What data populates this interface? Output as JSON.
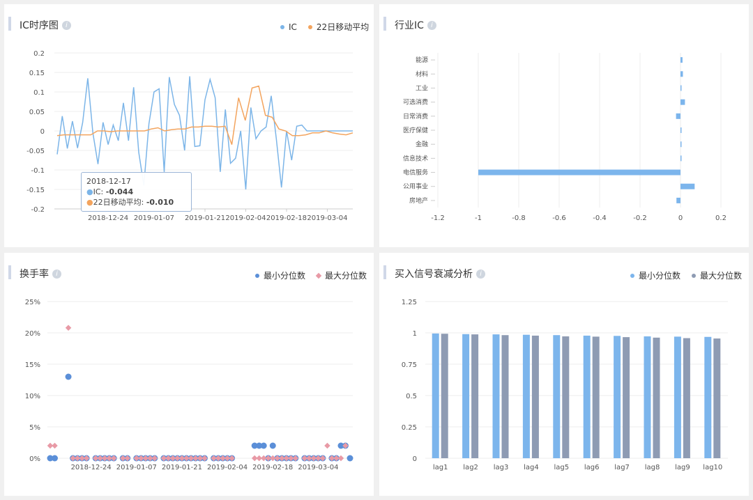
{
  "panels": {
    "p1": {
      "title": "IC时序图"
    },
    "p2": {
      "title": "行业IC"
    },
    "p3": {
      "title": "换手率"
    },
    "p4": {
      "title": "买入信号衰减分析"
    }
  },
  "colors": {
    "ic": "#7cb5e8",
    "ma": "#f3a45e",
    "min_q": "#5b8fd8",
    "max_q": "#e89aa6",
    "bar_blue": "#7cb5ec",
    "bar_gray": "#8e9bb3"
  },
  "tooltip": {
    "date": "2018-12-17",
    "ic_label": "IC: ",
    "ic_value": "-0.044",
    "ma_label": "22日移动平均: ",
    "ma_value": "-0.010"
  },
  "chart_data": [
    {
      "type": "line",
      "legend": [
        "IC",
        "22日移动平均"
      ],
      "ylim": [
        -0.2,
        0.2
      ],
      "yticks": [
        "0.2",
        "0.15",
        "0.1",
        "0.05",
        "0",
        "-0.05",
        "-0.1",
        "-0.15",
        "-0.2"
      ],
      "xticks": [
        "2018-12-24",
        "2019-01-07",
        "2019-01-21",
        "2019-02-04",
        "2019-02-18",
        "2019-03-04"
      ],
      "series": [
        {
          "name": "IC",
          "x": [
            "2018-12-10",
            "2018-12-11",
            "2018-12-12",
            "2018-12-13",
            "2018-12-14",
            "2018-12-17",
            "2018-12-18",
            "2018-12-19",
            "2018-12-20",
            "2018-12-21",
            "2018-12-24",
            "2018-12-25",
            "2018-12-26",
            "2018-12-27",
            "2018-12-28",
            "2019-01-02",
            "2019-01-03",
            "2019-01-04",
            "2019-01-07",
            "2019-01-08",
            "2019-01-09",
            "2019-01-10",
            "2019-01-11",
            "2019-01-14",
            "2019-01-15",
            "2019-01-16",
            "2019-01-17",
            "2019-01-18",
            "2019-01-21",
            "2019-01-22",
            "2019-01-23",
            "2019-01-24",
            "2019-01-25",
            "2019-01-28",
            "2019-01-29",
            "2019-01-30",
            "2019-01-31",
            "2019-02-01",
            "2019-02-11",
            "2019-02-12",
            "2019-02-13",
            "2019-02-14",
            "2019-02-15",
            "2019-02-18",
            "2019-02-19",
            "2019-02-20",
            "2019-02-21",
            "2019-02-22",
            "2019-02-25",
            "2019-02-26",
            "2019-02-27",
            "2019-02-28",
            "2019-03-01",
            "2019-03-04",
            "2019-03-05",
            "2019-03-06",
            "2019-03-07",
            "2019-03-08",
            "2019-03-11"
          ],
          "values": [
            -0.06,
            0.038,
            -0.045,
            0.025,
            -0.044,
            0.022,
            0.135,
            -0.005,
            -0.085,
            0.022,
            -0.035,
            0.015,
            -0.025,
            0.072,
            -0.025,
            0.112,
            -0.055,
            -0.14,
            0.018,
            0.1,
            0.108,
            -0.105,
            0.138,
            0.068,
            0.04,
            -0.05,
            0.14,
            -0.04,
            -0.038,
            0.08,
            0.132,
            0.085,
            -0.105,
            0.055,
            -0.083,
            -0.07,
            0.0,
            -0.15,
            0.06,
            -0.02,
            0.0,
            0.01,
            0.09,
            -0.02,
            -0.145,
            0.0,
            -0.075,
            0.012,
            0.015,
            0.0,
            0.0,
            0.0,
            0.0,
            0.0,
            0.0,
            0.0,
            0.0,
            0.0,
            0.0
          ]
        },
        {
          "name": "22日移动平均",
          "values": [
            -0.012,
            -0.01,
            -0.01,
            -0.01,
            -0.01,
            -0.01,
            0.0,
            0.0,
            -0.002,
            0.0,
            0.0,
            0.0,
            0.0,
            0.0,
            0.005,
            0.008,
            0.0,
            0.003,
            0.005,
            0.005,
            0.01,
            0.01,
            0.012,
            0.012,
            0.01,
            0.012,
            -0.035,
            0.085,
            0.027,
            0.11,
            0.115,
            0.04,
            0.035,
            0.005,
            0.0,
            -0.012,
            -0.012,
            -0.01,
            -0.005,
            -0.005,
            0.0,
            -0.005,
            -0.008,
            -0.01,
            -0.005
          ]
        }
      ]
    },
    {
      "type": "bar",
      "orientation": "horizontal",
      "categories": [
        "能源",
        "材料",
        "工业",
        "可选消费",
        "日常消费",
        "医疗保健",
        "金融",
        "信息技术",
        "电信服务",
        "公用事业",
        "房地产"
      ],
      "values": [
        0.01,
        0.012,
        0.0,
        0.022,
        -0.022,
        0.0,
        0.005,
        0.0,
        -1.0,
        0.07,
        -0.02
      ],
      "xticks": [
        "-1.2",
        "-1",
        "-0.8",
        "-0.6",
        "-0.4",
        "-0.2",
        "0",
        "0.2"
      ],
      "xlim": [
        -1.2,
        0.2
      ]
    },
    {
      "type": "scatter",
      "legend": [
        "最小分位数",
        "最大分位数"
      ],
      "yticks": [
        "25%",
        "20%",
        "15%",
        "10%",
        "5%",
        "0%"
      ],
      "ylim": [
        0,
        25
      ],
      "xticks": [
        "2018-12-24",
        "2019-01-07",
        "2019-01-21",
        "2019-02-04",
        "2019-02-18",
        "2019-03-04"
      ],
      "series": [
        {
          "name": "最小分位数",
          "points": [
            [
              0,
              0
            ],
            [
              1,
              0
            ],
            [
              4,
              13
            ],
            [
              5,
              0
            ],
            [
              6,
              0
            ],
            [
              7,
              0
            ],
            [
              8,
              0
            ],
            [
              10,
              0
            ],
            [
              11,
              0
            ],
            [
              12,
              0
            ],
            [
              13,
              0
            ],
            [
              14,
              0
            ],
            [
              16,
              0
            ],
            [
              17,
              0
            ],
            [
              19,
              0
            ],
            [
              20,
              0
            ],
            [
              21,
              0
            ],
            [
              22,
              0
            ],
            [
              23,
              0
            ],
            [
              25,
              0
            ],
            [
              26,
              0
            ],
            [
              27,
              0
            ],
            [
              28,
              0
            ],
            [
              29,
              0
            ],
            [
              30,
              0
            ],
            [
              31,
              0
            ],
            [
              32,
              0
            ],
            [
              33,
              0
            ],
            [
              34,
              0
            ],
            [
              36,
              0
            ],
            [
              37,
              0
            ],
            [
              38,
              0
            ],
            [
              39,
              0
            ],
            [
              40,
              0
            ],
            [
              45,
              2
            ],
            [
              46,
              2
            ],
            [
              47,
              2
            ],
            [
              48,
              0
            ],
            [
              49,
              2
            ],
            [
              50,
              0
            ],
            [
              51,
              0
            ],
            [
              52,
              0
            ],
            [
              53,
              0
            ],
            [
              54,
              0
            ],
            [
              56,
              0
            ],
            [
              57,
              0
            ],
            [
              58,
              0
            ],
            [
              59,
              0
            ],
            [
              60,
              0
            ],
            [
              62,
              0
            ],
            [
              63,
              0
            ],
            [
              64,
              2
            ],
            [
              65,
              2
            ],
            [
              66,
              0
            ]
          ]
        },
        {
          "name": "最大分位数",
          "points": [
            [
              0,
              2
            ],
            [
              1,
              2
            ],
            [
              4,
              20.8
            ],
            [
              5,
              0
            ],
            [
              6,
              0
            ],
            [
              7,
              0
            ],
            [
              8,
              0
            ],
            [
              10,
              0
            ],
            [
              11,
              0
            ],
            [
              12,
              0
            ],
            [
              13,
              0
            ],
            [
              14,
              0
            ],
            [
              16,
              0
            ],
            [
              17,
              0
            ],
            [
              19,
              0
            ],
            [
              20,
              0
            ],
            [
              21,
              0
            ],
            [
              22,
              0
            ],
            [
              23,
              0
            ],
            [
              25,
              0
            ],
            [
              26,
              0
            ],
            [
              27,
              0
            ],
            [
              28,
              0
            ],
            [
              29,
              0
            ],
            [
              30,
              0
            ],
            [
              31,
              0
            ],
            [
              32,
              0
            ],
            [
              33,
              0
            ],
            [
              34,
              0
            ],
            [
              36,
              0
            ],
            [
              37,
              0
            ],
            [
              38,
              0
            ],
            [
              39,
              0
            ],
            [
              40,
              0
            ],
            [
              45,
              0
            ],
            [
              46,
              0
            ],
            [
              47,
              0
            ],
            [
              48,
              0
            ],
            [
              49,
              0
            ],
            [
              50,
              0
            ],
            [
              51,
              0
            ],
            [
              52,
              0
            ],
            [
              53,
              0
            ],
            [
              54,
              0
            ],
            [
              56,
              0
            ],
            [
              57,
              0
            ],
            [
              58,
              0
            ],
            [
              59,
              0
            ],
            [
              60,
              0
            ],
            [
              61,
              2
            ],
            [
              62,
              0
            ],
            [
              63,
              0
            ],
            [
              64,
              0
            ],
            [
              65,
              2
            ]
          ]
        }
      ]
    },
    {
      "type": "bar",
      "legend": [
        "最小分位数",
        "最大分位数"
      ],
      "categories": [
        "lag1",
        "lag2",
        "lag3",
        "lag4",
        "lag5",
        "lag6",
        "lag7",
        "lag8",
        "lag9",
        "lag10"
      ],
      "yticks": [
        "1.25",
        "1",
        "0.75",
        "0.5",
        "0.25",
        "0"
      ],
      "ylim": [
        0,
        1.25
      ],
      "series": [
        {
          "name": "最小分位数",
          "values": [
            0.995,
            0.99,
            0.988,
            0.985,
            0.982,
            0.978,
            0.976,
            0.972,
            0.97,
            0.968
          ]
        },
        {
          "name": "最大分位数",
          "values": [
            0.993,
            0.988,
            0.982,
            0.978,
            0.972,
            0.97,
            0.966,
            0.962,
            0.958,
            0.955
          ]
        }
      ]
    }
  ]
}
